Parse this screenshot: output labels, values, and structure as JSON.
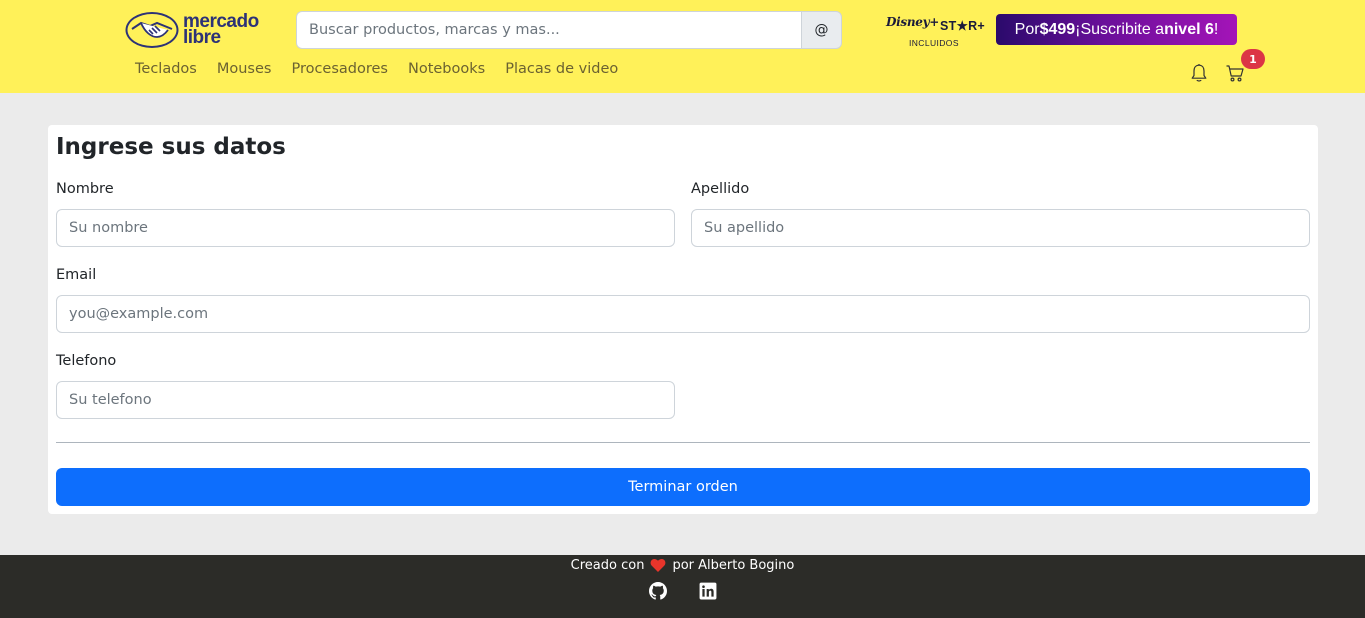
{
  "header": {
    "logo_line1": "mercado",
    "logo_line2": "libre",
    "search": {
      "placeholder": "Buscar productos, marcas y mas...",
      "button_label": "@"
    },
    "promo": {
      "brand_disney": "Disney+",
      "brand_star": "ST★R+",
      "brand_included": "INCLUIDOS",
      "prefix": "Por ",
      "price": "$499",
      "middle": " ¡Suscribite a ",
      "level": "nivel 6",
      "suffix": "!"
    },
    "nav": [
      "Teclados",
      "Mouses",
      "Procesadores",
      "Notebooks",
      "Placas de video"
    ],
    "cart_count": "1"
  },
  "form": {
    "title": "Ingrese sus datos",
    "nombre": {
      "label": "Nombre",
      "placeholder": "Su nombre",
      "value": ""
    },
    "apellido": {
      "label": "Apellido",
      "placeholder": "Su apellido",
      "value": ""
    },
    "email": {
      "label": "Email",
      "placeholder": "you@example.com",
      "value": ""
    },
    "telefono": {
      "label": "Telefono",
      "placeholder": "Su telefono",
      "value": ""
    },
    "submit_label": "Terminar orden"
  },
  "footer": {
    "text_before": "Creado con",
    "text_after": "por Alberto Bogino"
  },
  "colors": {
    "header_bg": "#fff159",
    "primary": "#0d6efd",
    "badge": "#dc3545",
    "footer_bg": "#2c2c28",
    "heart": "#e8352b"
  },
  "icons": [
    "handshake-logo-icon",
    "bell-icon",
    "cart-icon",
    "heart-icon",
    "github-icon",
    "linkedin-icon"
  ]
}
